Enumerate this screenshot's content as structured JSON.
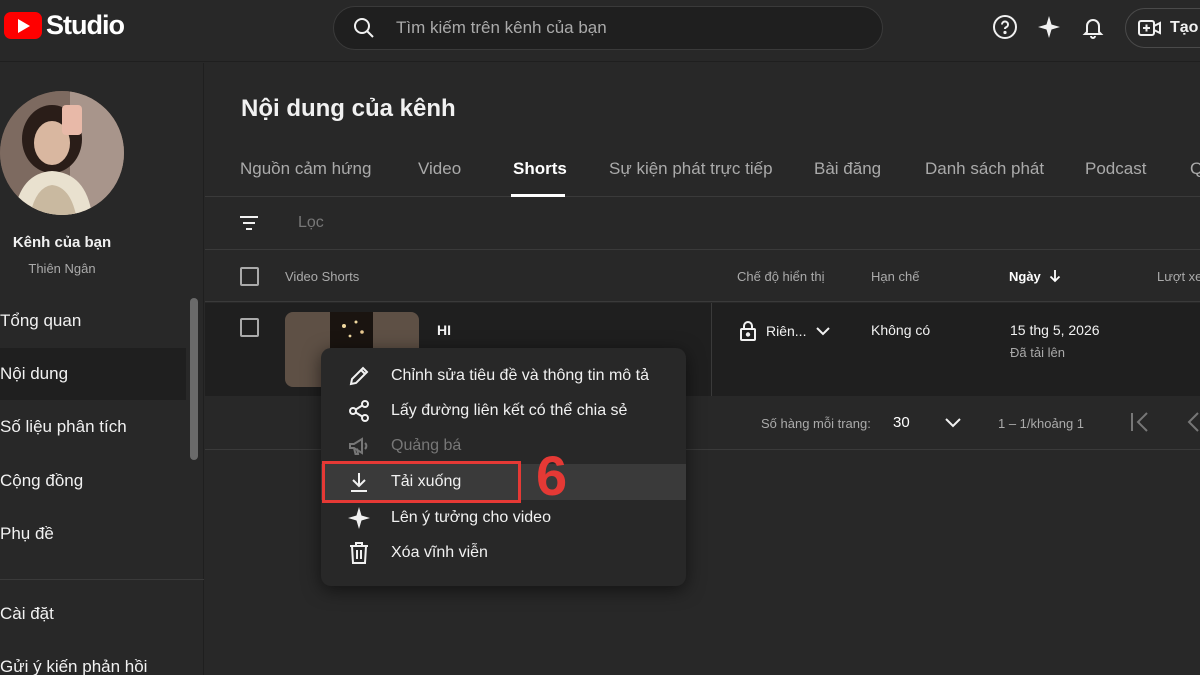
{
  "app": {
    "logo_text": "Studio",
    "brand_color": "#ff0000"
  },
  "search": {
    "placeholder": "Tìm kiếm trên kênh của bạn"
  },
  "header": {
    "create_label": "Tạo"
  },
  "channel": {
    "name": "Kênh của bạn",
    "handle": "Thiên Ngân"
  },
  "sidebar": {
    "items": [
      {
        "label": "Tổng quan",
        "active": false
      },
      {
        "label": "Nội dung",
        "active": true
      },
      {
        "label": "Số liệu phân tích",
        "active": false
      },
      {
        "label": "Cộng đồng",
        "active": false
      },
      {
        "label": "Phụ đề",
        "active": false
      },
      {
        "label": "Cài đặt",
        "active": false
      },
      {
        "label": "Gửi ý kiến phản hồi",
        "active": false
      }
    ]
  },
  "main": {
    "title": "Nội dung của kênh",
    "tabs": [
      {
        "label": "Nguồn cảm hứng"
      },
      {
        "label": "Video"
      },
      {
        "label": "Shorts",
        "active": true
      },
      {
        "label": "Sự kiện phát trực tiếp"
      },
      {
        "label": "Bài đăng"
      },
      {
        "label": "Danh sách phát"
      },
      {
        "label": "Podcast"
      },
      {
        "label": "Q"
      }
    ],
    "filter_placeholder": "Lọc",
    "columns": {
      "video": "Video Shorts",
      "visibility": "Chế độ hiển thị",
      "restrictions": "Hạn chế",
      "date": "Ngày",
      "views": "Lượt xe"
    },
    "rows": [
      {
        "title": "HI",
        "visibility": "Riên...",
        "restrictions": "Không có",
        "date": "15 thg 5, 2026",
        "date_status": "Đã tải lên"
      }
    ],
    "pagination": {
      "rows_per_page_label": "Số hàng mỗi trang:",
      "rows_per_page": "30",
      "range": "1 – 1/khoảng 1"
    }
  },
  "context_menu": {
    "items": [
      {
        "label": "Chỉnh sửa tiêu đề và thông tin mô tả",
        "icon": "pencil-icon"
      },
      {
        "label": "Lấy đường liên kết có thể chia sẻ",
        "icon": "share-icon"
      },
      {
        "label": "Quảng bá",
        "icon": "megaphone-icon",
        "disabled": true
      },
      {
        "label": "Tải xuống",
        "icon": "download-icon",
        "highlighted": true
      },
      {
        "label": "Lên ý tưởng cho video",
        "icon": "sparkle-icon"
      },
      {
        "label": "Xóa vĩnh viễn",
        "icon": "trash-icon"
      }
    ]
  },
  "annotation": {
    "step_number": "6",
    "color": "#e53935"
  }
}
